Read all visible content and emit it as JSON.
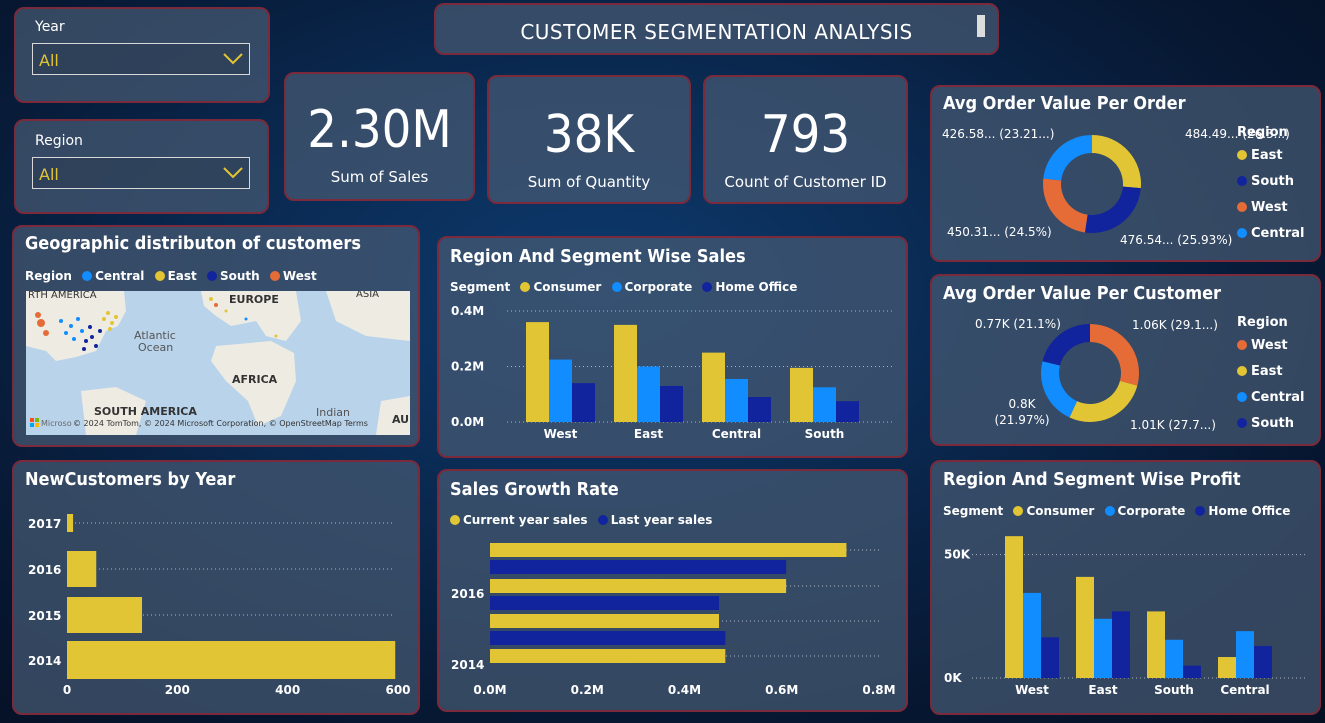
{
  "header": {
    "title": "CUSTOMER SEGMENTATION ANALYSIS"
  },
  "slicers": {
    "year": {
      "label": "Year",
      "value": "All"
    },
    "region": {
      "label": "Region",
      "value": "All"
    }
  },
  "kpis": [
    {
      "value": "2.30M",
      "label": "Sum of Sales"
    },
    {
      "value": "38K",
      "label": "Sum of Quantity"
    },
    {
      "value": "793",
      "label": "Count of Customer ID"
    }
  ],
  "map": {
    "title": "Geographic distributon of customers",
    "legend_title": "Region",
    "legend": [
      {
        "name": "Central",
        "color": "#118dff"
      },
      {
        "name": "East",
        "color": "#e2c534"
      },
      {
        "name": "South",
        "color": "#12239e"
      },
      {
        "name": "West",
        "color": "#e66c37"
      }
    ],
    "labels": {
      "north_america": "RTH AMERICA",
      "europe": "EUROPE",
      "asia": "ASIA",
      "atlantic": "Atlantic",
      "ocean": "Ocean",
      "africa": "AFRICA",
      "south_america": "SOUTH AMERICA",
      "indian": "Indian",
      "au": "AU"
    },
    "attribution": "© 2024 TomTom, © 2024 Microsoft Corporation, © OpenStreetMap  Terms",
    "ms_logo": "Microso"
  },
  "colors": {
    "consumer": "#e2c534",
    "corporate": "#118dff",
    "home_office": "#12239e",
    "west": "#e66c37",
    "east": "#e2c534",
    "central": "#118dff",
    "south": "#12239e"
  },
  "chart_data": [
    {
      "id": "region_segment_sales",
      "type": "bar",
      "title": "Region And Segment Wise Sales",
      "legend_title": "Segment",
      "categories": [
        "West",
        "East",
        "Central",
        "South"
      ],
      "series": [
        {
          "name": "Consumer",
          "values": [
            0.36,
            0.35,
            0.25,
            0.195
          ]
        },
        {
          "name": "Corporate",
          "values": [
            0.225,
            0.2,
            0.155,
            0.125
          ]
        },
        {
          "name": "Home Office",
          "values": [
            0.14,
            0.13,
            0.09,
            0.075
          ]
        }
      ],
      "yticks": [
        "0.0M",
        "0.2M",
        "0.4M"
      ],
      "ylim": [
        0,
        0.4
      ]
    },
    {
      "id": "avg_order_value_per_order",
      "type": "pie",
      "title": "Avg Order Value Per Order",
      "legend_title": "Region",
      "slices": [
        {
          "name": "East",
          "value": 484.49,
          "label": "484.49... (26.3...)"
        },
        {
          "name": "South",
          "value": 476.54,
          "label": "476.54... (25.93%)"
        },
        {
          "name": "West",
          "value": 450.31,
          "label": "450.31... (24.5%)"
        },
        {
          "name": "Central",
          "value": 426.58,
          "label": "426.58... (23.21...)"
        }
      ]
    },
    {
      "id": "avg_order_value_per_customer",
      "type": "pie",
      "title": "Avg Order Value Per Customer",
      "legend_title": "Region",
      "slices": [
        {
          "name": "West",
          "value": 29.1,
          "label": "1.06K (29.1...)"
        },
        {
          "name": "East",
          "value": 27.7,
          "label": "1.01K (27.7...)"
        },
        {
          "name": "Central",
          "value": 21.97,
          "label": "0.8K (21.97%)",
          "label_lines": [
            "0.8K",
            "(21.97%)"
          ]
        },
        {
          "name": "South",
          "value": 21.1,
          "label": "0.77K (21.1%)"
        }
      ]
    },
    {
      "id": "new_customers_by_year",
      "type": "bar",
      "orientation": "horizontal",
      "title": "NewCustomers by Year",
      "categories": [
        "2017",
        "2016",
        "2015",
        "2014"
      ],
      "values": [
        11,
        53,
        136,
        595
      ],
      "xticks": [
        "0",
        "200",
        "400",
        "600"
      ],
      "xlim": [
        0,
        600
      ]
    },
    {
      "id": "sales_growth_rate",
      "type": "bar",
      "orientation": "horizontal",
      "title": "Sales Growth Rate",
      "legend": [
        "Current year sales",
        "Last year sales"
      ],
      "rows": [
        {
          "series": "Current year sales",
          "value": 0.733
        },
        {
          "series": "Last year sales",
          "value": 0.609
        },
        {
          "series": "Current year sales",
          "value": 0.609
        },
        {
          "series": "Last year sales",
          "value": 0.471
        },
        {
          "series": "Current year sales",
          "value": 0.471
        },
        {
          "series": "Last year sales",
          "value": 0.484
        },
        {
          "series": "Current year sales",
          "value": 0.484
        }
      ],
      "ylabels": [
        "2016",
        "2014"
      ],
      "xticks": [
        "0.0M",
        "0.2M",
        "0.4M",
        "0.6M",
        "0.8M"
      ],
      "xlim": [
        0,
        0.8
      ]
    },
    {
      "id": "region_segment_profit",
      "type": "bar",
      "title": "Region And Segment Wise Profit",
      "legend_title": "Segment",
      "categories": [
        "West",
        "East",
        "South",
        "Central"
      ],
      "series": [
        {
          "name": "Consumer",
          "values": [
            57500,
            41000,
            27000,
            8500
          ]
        },
        {
          "name": "Corporate",
          "values": [
            34500,
            24000,
            15500,
            19000
          ]
        },
        {
          "name": "Home Office",
          "values": [
            16500,
            27000,
            5000,
            13000
          ]
        }
      ],
      "yticks": [
        "0K",
        "50K"
      ],
      "ylim": [
        0,
        60000
      ]
    }
  ]
}
